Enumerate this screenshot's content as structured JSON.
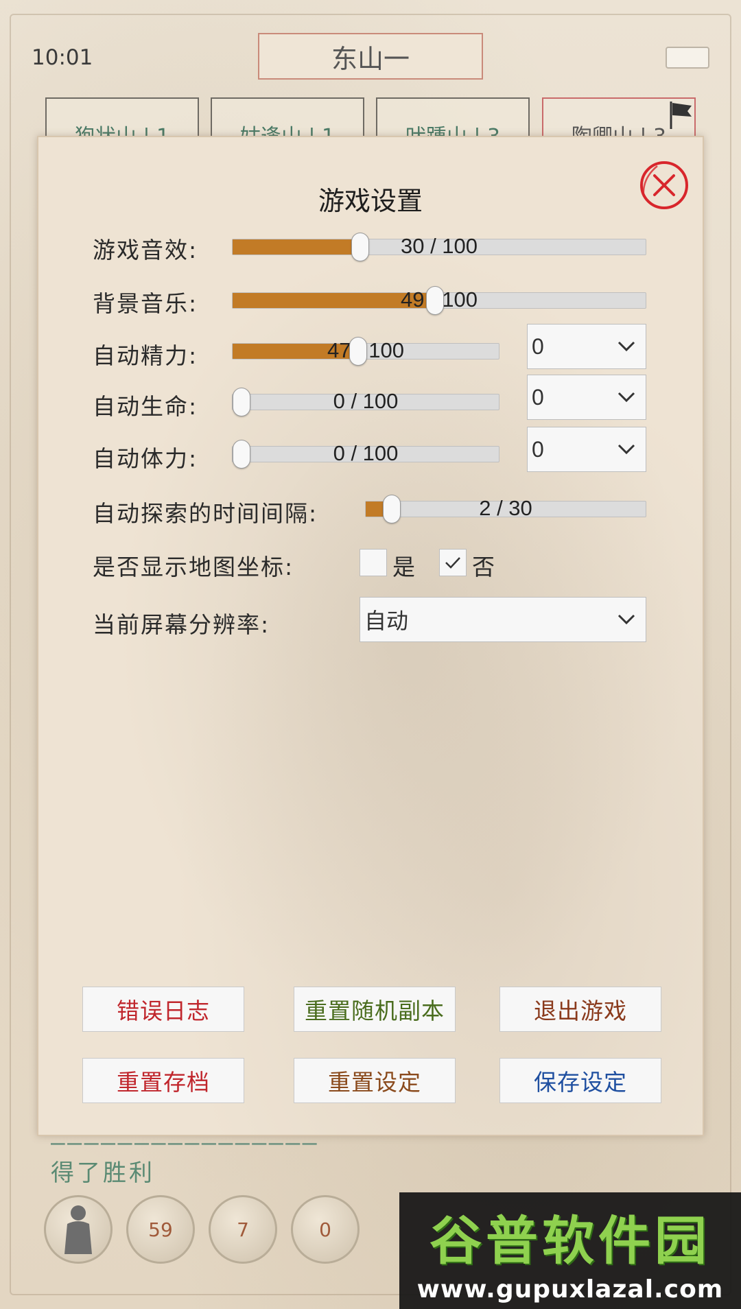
{
  "status_bar": {
    "time": "10:01"
  },
  "map_title": "东山一",
  "background_tabs": [
    "狍状山 | 1",
    "姑逢山 | 1",
    "吠踵山 | 3",
    "陶卿山 | 3"
  ],
  "background_log": [
    "得了胜利"
  ],
  "bottom_bar": {
    "badge_1": "59",
    "badge_2": "7",
    "badge_3": "0"
  },
  "watermark": {
    "main": "谷普软件园",
    "sub": "www.gupuxlazal.com"
  },
  "dialog": {
    "title": "游戏设置",
    "rows": {
      "sound": {
        "label": "游戏音效:",
        "value": 30,
        "max": 100,
        "text": "30 / 100"
      },
      "music": {
        "label": "背景音乐:",
        "value": 49,
        "max": 100,
        "text": "49 / 100"
      },
      "auto_energy": {
        "label": "自动精力:",
        "value": 47,
        "max": 100,
        "text": "47 / 100",
        "select": "0"
      },
      "auto_life": {
        "label": "自动生命:",
        "value": 0,
        "max": 100,
        "text": "0 / 100",
        "select": "0"
      },
      "auto_stamina": {
        "label": "自动体力:",
        "value": 0,
        "max": 100,
        "text": "0 / 100",
        "select": "0"
      },
      "explore_interval": {
        "label": "自动探索的时间间隔:",
        "value": 2,
        "max": 30,
        "text": "2 / 30"
      },
      "map_coords": {
        "label": "是否显示地图坐标:",
        "yes": "是",
        "no": "否",
        "yes_checked": false,
        "no_checked": true
      },
      "resolution": {
        "label": "当前屏幕分辨率:",
        "select": "自动"
      }
    },
    "buttons": {
      "error_log": "错误日志",
      "reset_random_dungeon": "重置随机副本",
      "quit_game": "退出游戏",
      "reset_save": "重置存档",
      "reset_settings": "重置设定",
      "save_settings": "保存设定"
    }
  },
  "colors": {
    "slider_fill": "#c27b26",
    "red_text": "#c0262c",
    "green_text": "#4a6d1e",
    "brown_text": "#8a4a1c",
    "blue_text": "#1f4fa0",
    "close_red": "#d8262c"
  }
}
